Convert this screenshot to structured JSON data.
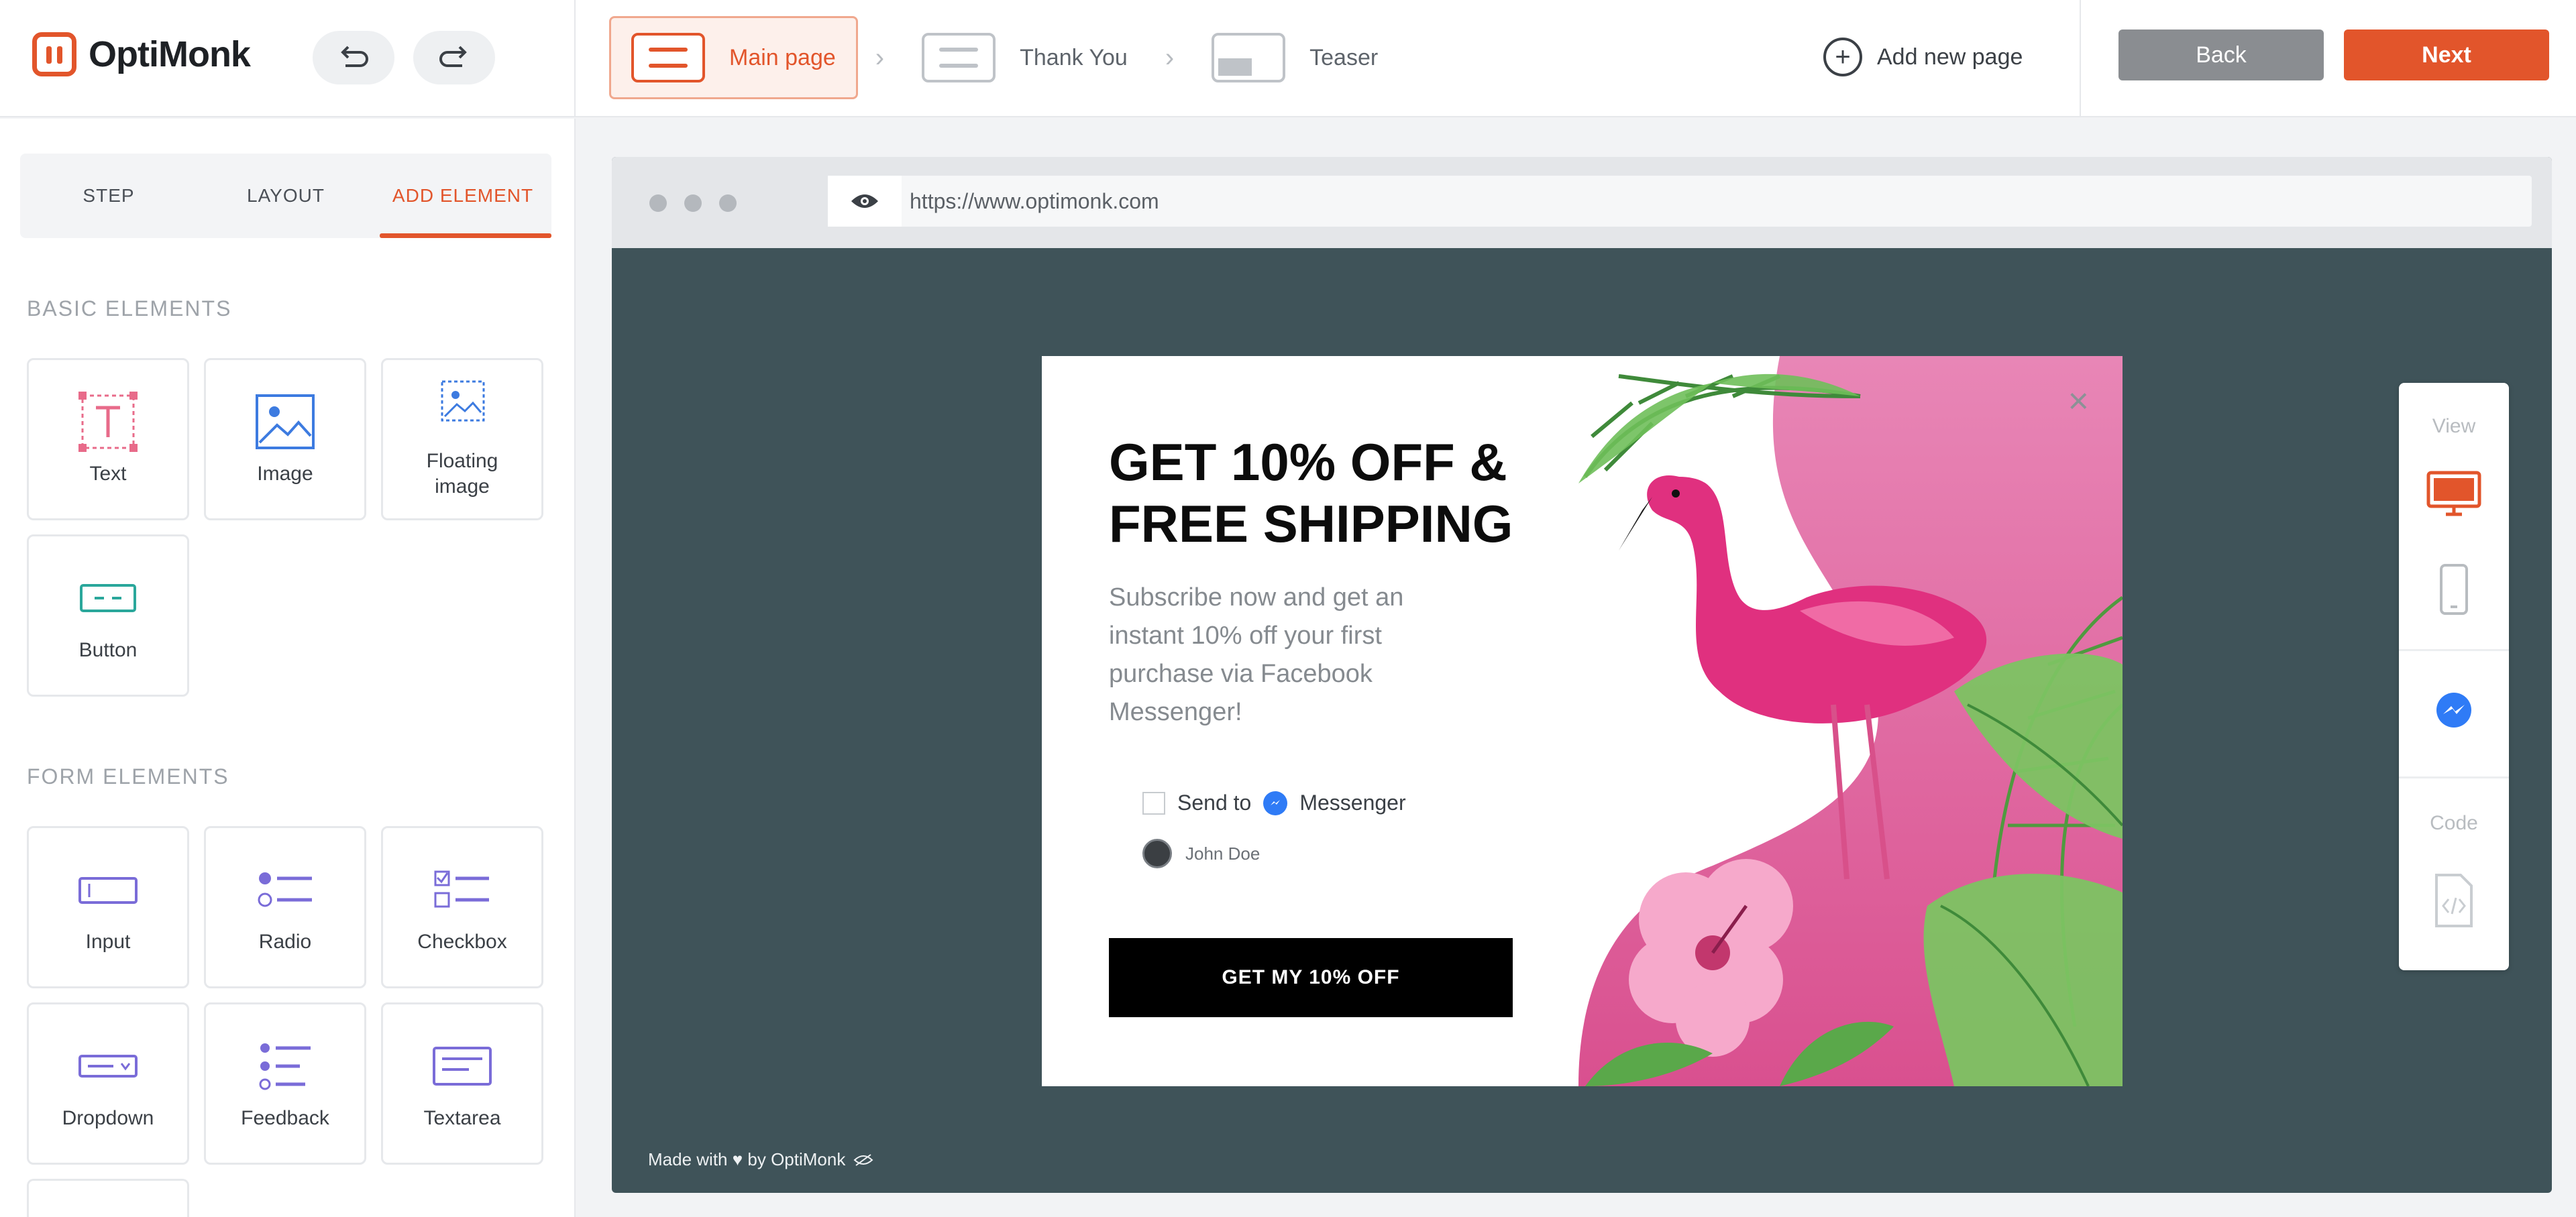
{
  "app": {
    "logo_text": "OptiMonk",
    "accent_color": "#e2552b"
  },
  "header": {
    "steps": [
      {
        "label": "Main page",
        "active": true
      },
      {
        "label": "Thank You",
        "active": false
      },
      {
        "label": "Teaser",
        "active": false
      }
    ],
    "step_separator": "›",
    "add_new_page": "Add new page",
    "back_label": "Back",
    "next_label": "Next",
    "undo_icon": "undo-icon",
    "redo_icon": "redo-icon"
  },
  "sidebar": {
    "tabs": [
      {
        "label": "STEP",
        "active": false
      },
      {
        "label": "LAYOUT",
        "active": false
      },
      {
        "label": "ADD ELEMENT",
        "active": true
      }
    ],
    "basic_title": "BASIC ELEMENTS",
    "basic_elements": [
      {
        "label": "Text",
        "icon": "text-icon"
      },
      {
        "label": "Image",
        "icon": "image-icon"
      },
      {
        "label": "Floating\nimage",
        "icon": "floating-image-icon"
      },
      {
        "label": "Button",
        "icon": "button-icon"
      }
    ],
    "form_title": "FORM ELEMENTS",
    "form_elements": [
      {
        "label": "Input",
        "icon": "input-icon"
      },
      {
        "label": "Radio",
        "icon": "radio-icon"
      },
      {
        "label": "Checkbox",
        "icon": "checkbox-icon"
      },
      {
        "label": "Dropdown",
        "icon": "dropdown-icon"
      },
      {
        "label": "Feedback",
        "icon": "feedback-icon"
      },
      {
        "label": "Textarea",
        "icon": "textarea-icon"
      }
    ]
  },
  "preview": {
    "url": "https://www.optimonk.com",
    "made_with": "Made with ♥ by OptiMonk",
    "popup": {
      "headline": "GET 10% OFF & FREE SHIPPING",
      "subtext": "Subscribe now and get an instant 10% off your first purchase via Facebook Messenger!",
      "send_to": "Send to",
      "messenger": "Messenger",
      "user_name": "John Doe",
      "cta": "GET MY 10% OFF",
      "close_symbol": "×"
    }
  },
  "view_panel": {
    "view_label": "View",
    "code_label": "Code",
    "items": [
      "desktop-icon",
      "mobile-icon",
      "messenger-icon",
      "code-file-icon"
    ]
  }
}
